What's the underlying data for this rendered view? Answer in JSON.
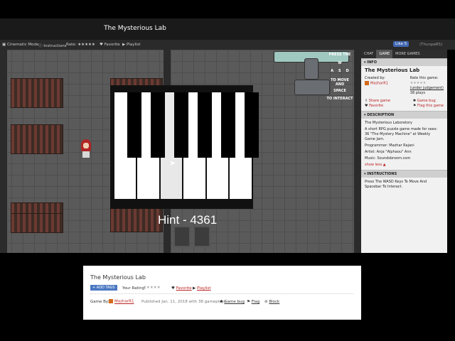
{
  "header": {
    "title": "The Mysterious Lab"
  },
  "toolbar": {
    "cinematic": "Cinematic Mode",
    "instructions": "Instructions",
    "rate": "Rate: ★★★★★",
    "favorite": "Favorite",
    "playlist": "Playlist",
    "like": "Like 5",
    "user": "(ThunpeR5)"
  },
  "game": {
    "controls": {
      "title": "PRESS THE",
      "w": "W",
      "a": "A",
      "s": "S",
      "d": "D",
      "move": "TO MOVE",
      "and": "AND",
      "space": "SPACE",
      "interact": "TO INTERACT"
    },
    "hint": "Hint - 4361",
    "piano": {
      "white_keys": 6,
      "pressed_key_index": 2
    }
  },
  "sidebar": {
    "tabs": [
      "CHAT",
      "GAME",
      "MORE GAMES"
    ],
    "info": {
      "header": "INFO",
      "title": "The Mysterious Lab",
      "created_by_label": "Created by:",
      "creator": "MazharR1",
      "rate_label": "Rate this game:",
      "rate_note": "(under judgement)",
      "plays": "38 plays",
      "share": "Share game",
      "game_bug": "Game bug",
      "favorite": "Favorite",
      "flag": "Flag this game"
    },
    "description": {
      "header": "DESCRIPTION",
      "line1": "The Mysterious Laboratory",
      "line2": "A short RPG puzzle game made for sees:",
      "line3": "36 \"The Mystery Machine\" at Weekly",
      "line4": "Game Jam.",
      "programmer": "Programmer: Mazhar Rajani",
      "artist": "Artist: Anja \"Alphaou\" Ann",
      "music": "Music: Soundsbroom.com",
      "more": "show less ▲"
    },
    "instructions": {
      "header": "INSTRUCTIONS",
      "text1": "Press The WASD Keys To Move And",
      "text2": "Spacebar To Interact."
    }
  },
  "lower": {
    "title": "The Mysterious Lab",
    "add_tags": "+ ADD TAGS",
    "your_rating": "Your Rating:",
    "stars": "★★★★★",
    "favorite": "Favorite",
    "playlist": "Playlist",
    "game_by": "Game By:",
    "creator": "MazharR1",
    "published": "Published Jan. 11, 2018 with 38 gameplays",
    "game_bug": "Game bug",
    "flag": "Flag",
    "block": "Block"
  }
}
